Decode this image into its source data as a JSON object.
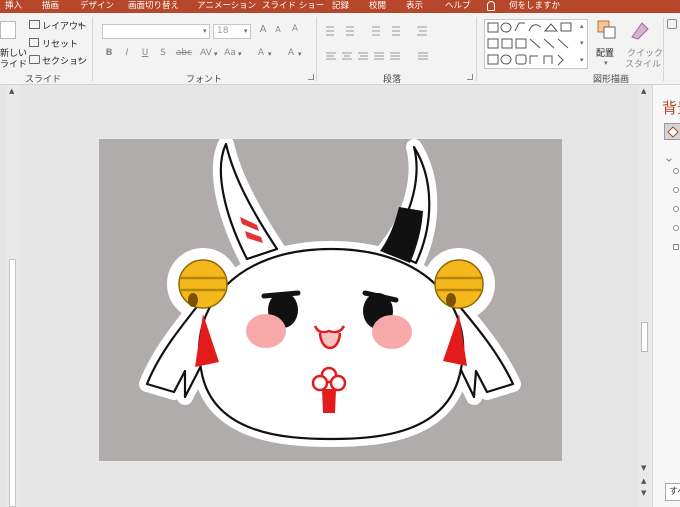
{
  "tabs": [
    "挿入",
    "描画",
    "デザイン",
    "画面切り替え",
    "アニメーション",
    "スライド ショー",
    "記録",
    "校閲",
    "表示",
    "ヘルプ"
  ],
  "tell_me": "何をしますか",
  "slides_group": {
    "new_slide": "新しい",
    "new_slide_2": "ライド",
    "layout": "レイアウト",
    "reset": "リセット",
    "section": "セクション",
    "label": "スライド"
  },
  "font_group": {
    "font_name": "",
    "font_size": "18",
    "grow": "A",
    "shrink": "A",
    "clear": "A",
    "bold": "B",
    "italic": "I",
    "underline": "U",
    "shadow": "S",
    "strike": "abc",
    "spacing": "AV",
    "case": "Aa",
    "color": "A",
    "label": "フォント"
  },
  "paragraph_group": {
    "label": "段落"
  },
  "drawing_group": {
    "arrange": "配置",
    "quick_styles": "クイック",
    "quick_styles_2": "スタイル",
    "label": "図形描画"
  },
  "pane": {
    "title": "背景",
    "apply_all": "すべ"
  },
  "colors": {
    "ribbon_accent": "#b7472a",
    "pane_title": "#b7472a",
    "slide_bg": "#b0acab"
  },
  "icons": [
    "lightbulb-icon",
    "new-slide-icon",
    "layout-icon",
    "reset-icon",
    "section-icon",
    "shape-gallery-icon",
    "arrange-icon",
    "quick-styles-icon",
    "fill-icon"
  ]
}
